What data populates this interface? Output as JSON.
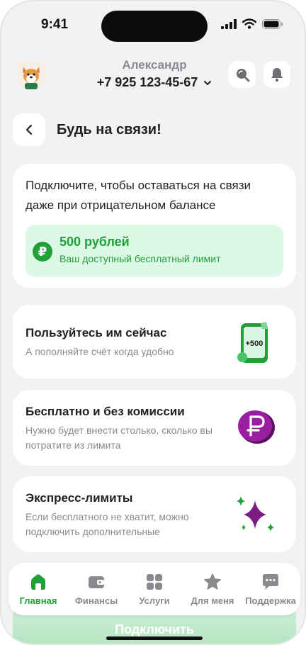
{
  "status_bar": {
    "time": "9:41"
  },
  "header": {
    "user_name": "Александр",
    "user_phone": "+7 925 123-45-67"
  },
  "page": {
    "title": "Будь на связи!"
  },
  "intro": {
    "text": "Подключите, чтобы оставаться на связи даже при отрицательном балансе",
    "limit_amount": "500 рублей",
    "limit_description": "Ваш доступный бесплатный лимит"
  },
  "features": [
    {
      "title": "Пользуйтесь им сейчас",
      "description": "А пополняйте счёт когда удобно",
      "icon": "phone-topup-icon",
      "icon_badge": "+500"
    },
    {
      "title": "Бесплатно и без комиссии",
      "description": "Нужно будет внести столько, сколько вы потратите из лимита",
      "icon": "ruble-coin-icon"
    },
    {
      "title": "Экспресс-лимиты",
      "description": "Если бесплатного не хватит, можно подключить дополнительные",
      "icon": "sparkle-icon"
    }
  ],
  "tabbar": {
    "tabs": [
      {
        "label": "Главная",
        "icon": "home-icon",
        "active": true
      },
      {
        "label": "Финансы",
        "icon": "wallet-icon",
        "active": false
      },
      {
        "label": "Услуги",
        "icon": "grid-icon",
        "active": false
      },
      {
        "label": "Для меня",
        "icon": "star-icon",
        "active": false
      },
      {
        "label": "Поддержка",
        "icon": "chat-icon",
        "active": false
      }
    ]
  },
  "connect_button": {
    "label": "Подключить"
  },
  "colors": {
    "accent_green": "#21a038",
    "light_green_bg": "#dcf8e6",
    "page_bg": "#f1f2f4",
    "muted_text": "#8a8a8e",
    "purple": "#8a1a8f"
  }
}
